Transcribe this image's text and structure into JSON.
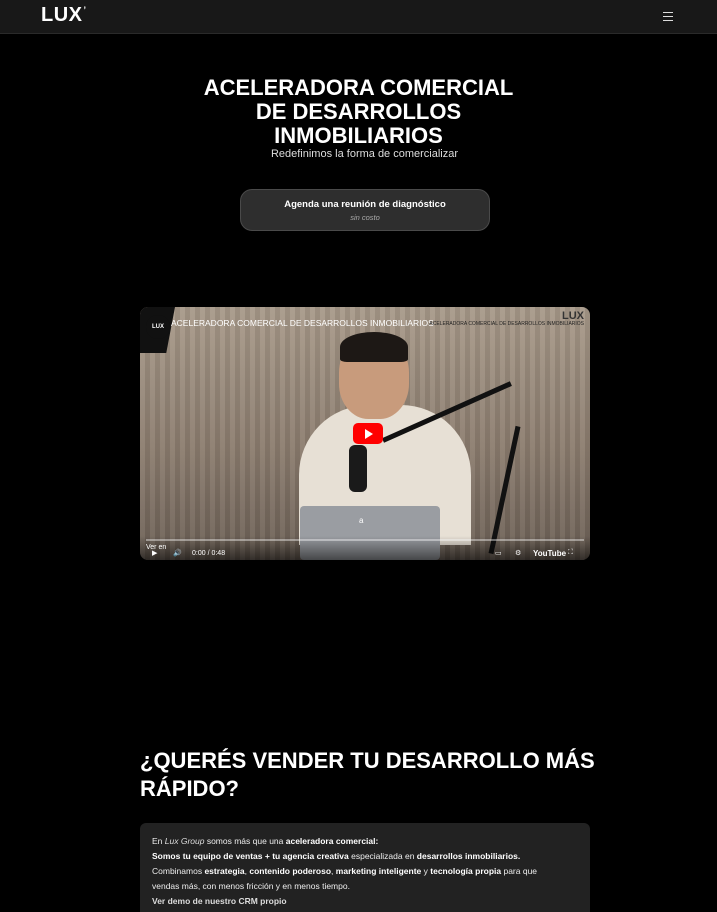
{
  "header": {
    "logo": "LUX",
    "logo_mark": "’",
    "menu_icon": "hamburger-icon"
  },
  "hero": {
    "title_line1": "ACELERADORA COMERCIAL",
    "title_line2": "DE DESARROLLOS",
    "title_line3": "INMOBILIARIOS",
    "subtitle": "Redefinimos la forma de comercializar",
    "cta_label": "Agenda una reunión de diagnóstico",
    "cta_sub": "sin costo"
  },
  "video": {
    "channel_avatar": "LUX",
    "title": "ACELERADORA COMERCIAL DE DESARROLLOS INMOBILIARIOS",
    "watermark_logo": "LUX",
    "watermark_text": "ACELERADORA COMERCIAL DE DESARROLLOS INMOBILIARIOS",
    "caption_text": "a",
    "watch_on": "Ver en",
    "time": "0:00 / 0:48",
    "youtube_label": "YouTube"
  },
  "section": {
    "title": "¿QUERÉS VENDER TU DESARROLLO MÁS RÁPIDO?",
    "p1_pre": "En ",
    "p1_brand": "Lux Group",
    "p1_mid": " somos más que una ",
    "p1_bold": "aceleradora comercial:",
    "p2_bold1": "Somos tu equipo de ventas + tu agencia creativa",
    "p2_mid": " especializada en ",
    "p2_bold2": "desarrollos inmobiliarios.",
    "p3_pre": "Combinamos ",
    "p3_b1": "estrategia",
    "p3_c1": ", ",
    "p3_b2": "contenido poderoso",
    "p3_c2": ", ",
    "p3_b3": "marketing inteligente",
    "p3_c3": " y ",
    "p3_b4": "tecnología propia",
    "p3_post": " para que",
    "p4": "vendas más, con menos fricción y en menos tiempo.",
    "link": "Ver demo de nuestro CRM propio"
  }
}
